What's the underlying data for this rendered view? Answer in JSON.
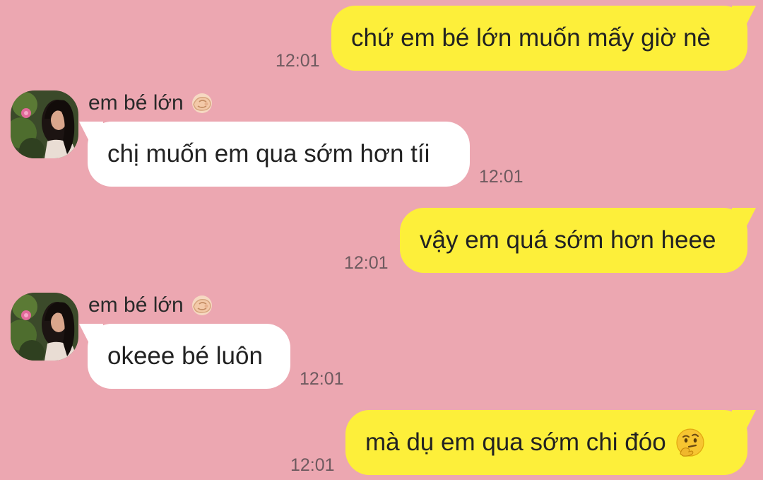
{
  "chat": {
    "background_color": "#eca7b1",
    "outgoing_bubble_color": "#fdef3a",
    "incoming_bubble_color": "#ffffff",
    "messages": [
      {
        "direction": "outgoing",
        "text": "chứ em bé lớn muốn mấy giờ nè",
        "time": "12:01"
      },
      {
        "direction": "incoming",
        "sender": "em bé lớn",
        "sender_emoji": "pinching-hand-emoji",
        "text": "chị muốn em qua sớm hơn tíi",
        "time": "12:01"
      },
      {
        "direction": "outgoing",
        "text": "vậy em quá sớm hơn heee",
        "time": "12:01"
      },
      {
        "direction": "incoming",
        "sender": "em bé lớn",
        "sender_emoji": "pinching-hand-emoji",
        "text": "okeee bé luôn",
        "time": "12:01"
      },
      {
        "direction": "outgoing",
        "text": "mà dụ em qua sớm chi đóo",
        "trailing_emoji": "thinking-face-emoji",
        "time": "12:01"
      }
    ]
  }
}
